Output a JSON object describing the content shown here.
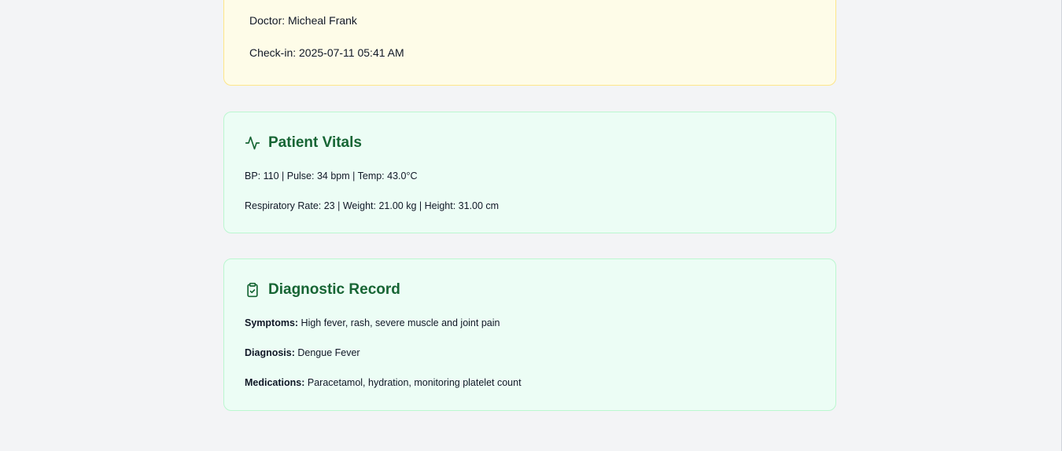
{
  "visit_info": {
    "doctor": "Doctor: Micheal Frank",
    "check_in": "Check-in: 2025-07-11 05:41 AM"
  },
  "vitals": {
    "title": "Patient Vitals",
    "icon": "activity-icon",
    "line1": "BP: 110 | Pulse: 34 bpm | Temp: 43.0°C",
    "line2": "Respiratory Rate: 23 | Weight: 21.00 kg | Height: 31.00 cm"
  },
  "diagnostic": {
    "title": "Diagnostic Record",
    "icon": "clipboard-check-icon",
    "symptoms_label": "Symptoms:",
    "symptoms_value": " High fever, rash, severe muscle and joint pain",
    "diagnosis_label": "Diagnosis:",
    "diagnosis_value": " Dengue Fever",
    "medications_label": "Medications:",
    "medications_value": " Paracetamol, hydration, monitoring platelet count"
  },
  "colors": {
    "page_bg": "#f3f4f6",
    "info_card_bg": "#fefce8",
    "green_card_bg": "#ecfdf5",
    "heading_green": "#166534"
  }
}
